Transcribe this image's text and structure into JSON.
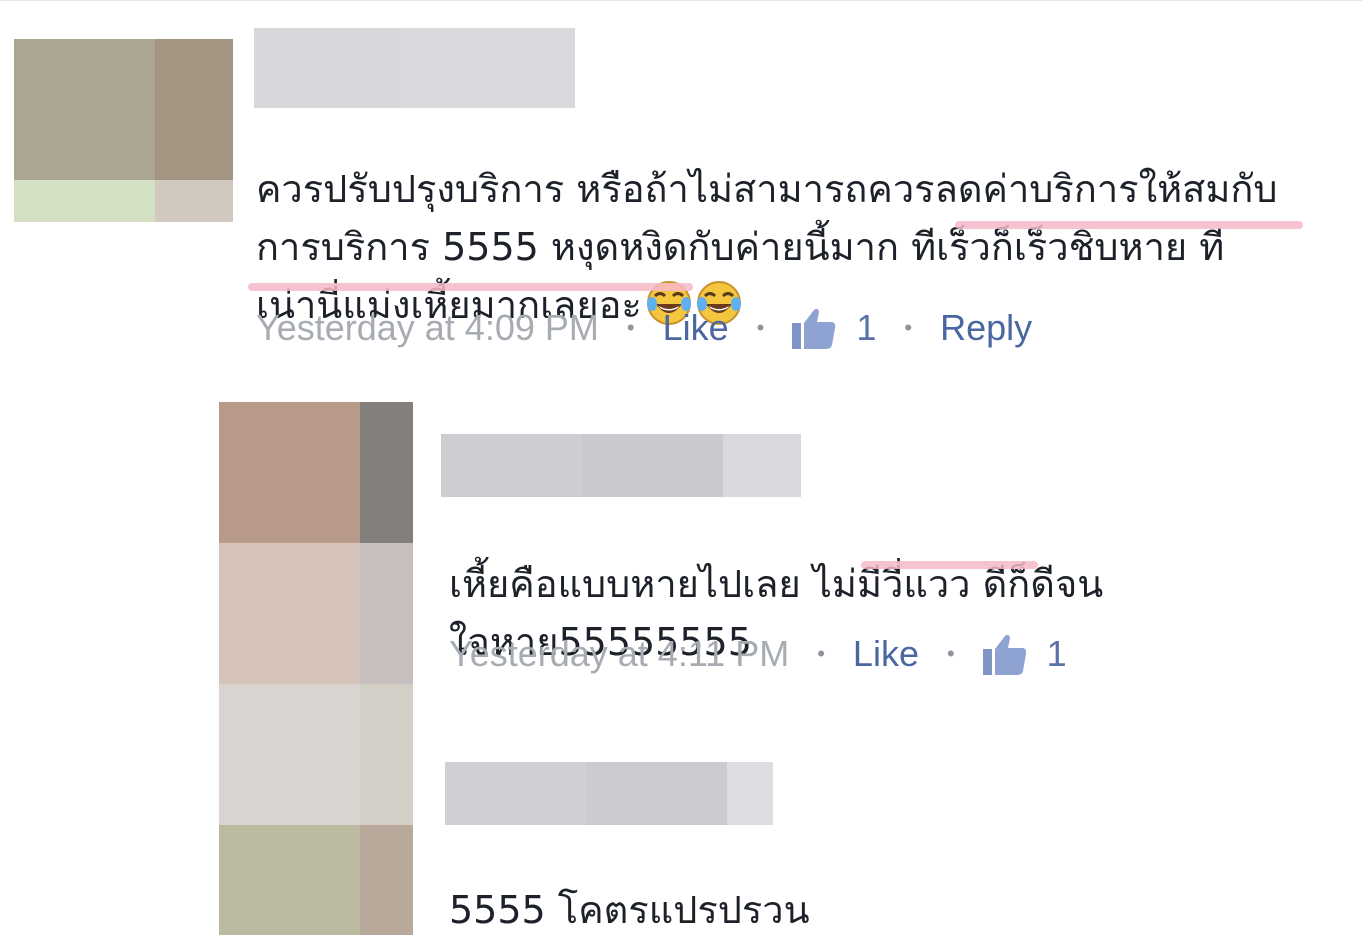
{
  "comments": [
    {
      "text": "ควรปรับปรุงบริการ หรือถ้าไม่สามารถควรลดค่าบริการให้สมกับ\nการบริการ 5555 หงุดหงิดกับค่ายนี้มาก ทีเร็วก็เร็วชิบหาย ที\nเน่านี่แม่งเหี้ยมากเลยอะ",
      "emoji": [
        "face-with-tears-of-joy",
        "face-with-tears-of-joy"
      ],
      "time": "Yesterday at 4:09 PM",
      "like_label": "Like",
      "reaction_count": "1",
      "reply_label": "Reply"
    },
    {
      "text": "เหี้ยคือแบบหายไปเลย ไม่มีวี่แวว ดีก็ดีจน\nใจหาย55555555",
      "time": "Yesterday at 4:11 PM",
      "like_label": "Like",
      "reaction_count": "1"
    },
    {
      "text": "5555 โคตรแปรปรวน"
    }
  ],
  "colors": {
    "link": "#4b67a1",
    "timestamp": "#a7abb2",
    "text": "#1d2129",
    "highlight_underline": "#f7b8c8"
  },
  "icons": {
    "like": "thumbs-up-icon",
    "emoji": "face-with-tears-of-joy"
  }
}
